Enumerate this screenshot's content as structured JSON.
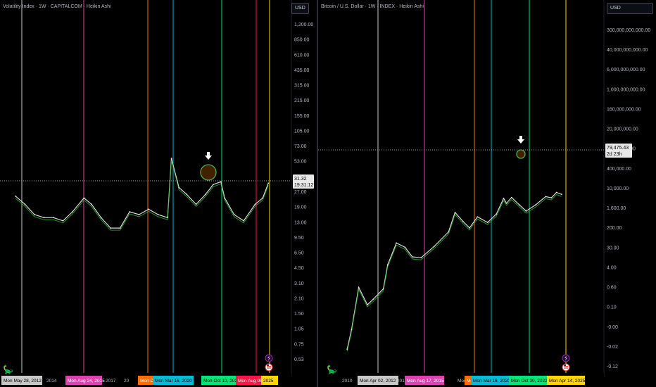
{
  "chart_data": [
    {
      "type": "line",
      "title": "Volatility Index · 1W · CAPITALCOM · Heikin Ashi",
      "currency": "USD",
      "y_scale": "log",
      "y_ticks": [
        "1,200.00",
        "850.00",
        "610.00",
        "435.00",
        "315.00",
        "215.00",
        "155.00",
        "105.00",
        "73.00",
        "53.00",
        "37.00",
        "27.00",
        "19.00",
        "13.00",
        "9.50",
        "6.50",
        "4.50",
        "3.10",
        "2.10",
        "1.50",
        "1.05",
        "0.75",
        "0.53"
      ],
      "x_ticks": [
        "2014",
        "2017",
        "20"
      ],
      "current_price": "31.32",
      "countdown": "19:31:12",
      "vertical_markers": [
        {
          "label": "Mon May 28, 2012",
          "color": "#c8c8c8"
        },
        {
          "label": "Mon Aug 24, 2015",
          "color": "#e040b0"
        },
        {
          "label": "Mon Dec 1",
          "color": "#ff6d00"
        },
        {
          "label": "Mon Mar 16, 2020",
          "color": "#00bcd4"
        },
        {
          "label": "Mon Oct 10, 2022",
          "color": "#00e676"
        },
        {
          "label": "Mon Aug 05, 2024",
          "color": "#ff1744"
        },
        {
          "label": "2025",
          "color": "#ffd600"
        }
      ],
      "series": [
        {
          "x": "2012",
          "y": 23
        },
        {
          "x": "2012.5",
          "y": 19
        },
        {
          "x": "2013",
          "y": 15
        },
        {
          "x": "2013.5",
          "y": 14
        },
        {
          "x": "2014",
          "y": 14
        },
        {
          "x": "2014.5",
          "y": 13
        },
        {
          "x": "2015",
          "y": 16
        },
        {
          "x": "2015.6",
          "y": 22
        },
        {
          "x": "2016",
          "y": 19
        },
        {
          "x": "2016.5",
          "y": 14
        },
        {
          "x": "2017",
          "y": 11
        },
        {
          "x": "2017.5",
          "y": 11
        },
        {
          "x": "2018",
          "y": 16
        },
        {
          "x": "2018.5",
          "y": 15
        },
        {
          "x": "2019",
          "y": 17
        },
        {
          "x": "2019.5",
          "y": 15
        },
        {
          "x": "2020",
          "y": 14
        },
        {
          "x": "2020.2",
          "y": 55
        },
        {
          "x": "2020.6",
          "y": 28
        },
        {
          "x": "2021",
          "y": 24
        },
        {
          "x": "2021.5",
          "y": 19
        },
        {
          "x": "2022",
          "y": 24
        },
        {
          "x": "2022.4",
          "y": 30
        },
        {
          "x": "2022.8",
          "y": 32
        },
        {
          "x": "2023",
          "y": 22
        },
        {
          "x": "2023.5",
          "y": 15
        },
        {
          "x": "2024",
          "y": 13
        },
        {
          "x": "2024.6",
          "y": 19
        },
        {
          "x": "2025",
          "y": 22
        },
        {
          "x": "2025.3",
          "y": 31
        }
      ]
    },
    {
      "type": "line",
      "title": "Bitcoin / U.S. Dollar · 1W · INDEX · Heikin Ashi",
      "currency": "USD",
      "y_scale": "log",
      "y_ticks": [
        "300,000,000,000.00",
        "40,000,000,000.00",
        "6,000,000,000.00",
        "1,000,000,000.00",
        "160,000,000.00",
        "20,000,000.00",
        "3,000,000.00",
        "400,000.00",
        "10,000.00",
        "1,600.00",
        "200.00",
        "30.00",
        "4.00",
        "0.60",
        "0.10",
        "-0.00",
        "-0.02",
        "-0.12"
      ],
      "x_ticks": [
        "2010",
        "201",
        "Mon Dec"
      ],
      "current_price": "79,475.43",
      "countdown": "2d 23h",
      "vertical_markers": [
        {
          "label": "Mon Apr 02, 2012",
          "color": "#c8c8c8"
        },
        {
          "label": "Mon Aug 17, 2015",
          "color": "#e040b0"
        },
        {
          "label": "Mon Dec",
          "color": "#ff6d00"
        },
        {
          "label": "Mon Mar 16, 2020",
          "color": "#00bcd4"
        },
        {
          "label": "Mon Oct 30, 2022",
          "color": "#00e676"
        },
        {
          "label": "Mon Apr 14, 2025",
          "color": "#ffd600"
        }
      ],
      "series": [
        {
          "x": "2010.5",
          "y": 0.05
        },
        {
          "x": "2010.8",
          "y": 0.3
        },
        {
          "x": "2011.3",
          "y": 15
        },
        {
          "x": "2011.9",
          "y": 3
        },
        {
          "x": "2012.3",
          "y": 5
        },
        {
          "x": "2013",
          "y": 13
        },
        {
          "x": "2013.3",
          "y": 120
        },
        {
          "x": "2013.9",
          "y": 900
        },
        {
          "x": "2014.5",
          "y": 600
        },
        {
          "x": "2015",
          "y": 250
        },
        {
          "x": "2015.6",
          "y": 230
        },
        {
          "x": "2016.5",
          "y": 650
        },
        {
          "x": "2017.5",
          "y": 2500
        },
        {
          "x": "2017.95",
          "y": 15000
        },
        {
          "x": "2018.5",
          "y": 6500
        },
        {
          "x": "2018.95",
          "y": 3600
        },
        {
          "x": "2019.5",
          "y": 10000
        },
        {
          "x": "2020.2",
          "y": 6000
        },
        {
          "x": "2020.8",
          "y": 13000
        },
        {
          "x": "2021.3",
          "y": 55000
        },
        {
          "x": "2021.5",
          "y": 35000
        },
        {
          "x": "2021.85",
          "y": 60000
        },
        {
          "x": "2022.4",
          "y": 30000
        },
        {
          "x": "2022.85",
          "y": 17000
        },
        {
          "x": "2023.5",
          "y": 30000
        },
        {
          "x": "2024.2",
          "y": 65000
        },
        {
          "x": "2024.6",
          "y": 58000
        },
        {
          "x": "2024.95",
          "y": 95000
        },
        {
          "x": "2025.3",
          "y": 80000
        }
      ]
    }
  ],
  "left_bottom_extra": "2025"
}
